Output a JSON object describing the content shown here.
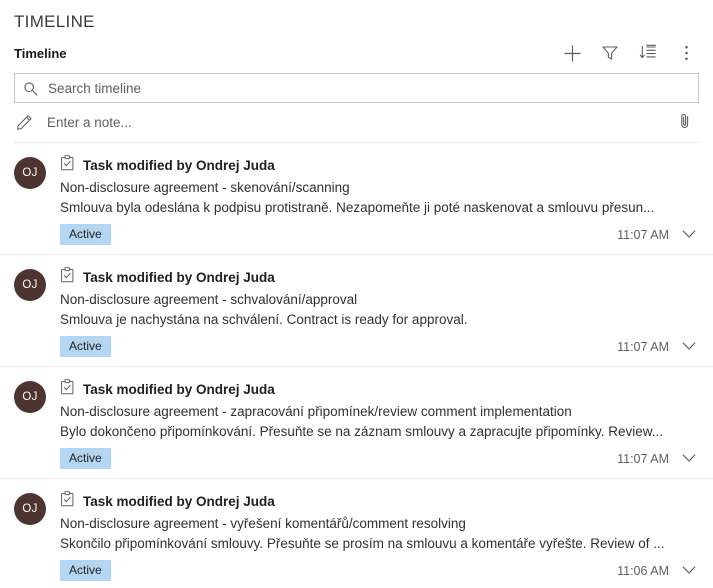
{
  "panel": {
    "title": "TIMELINE",
    "section_label": "Timeline"
  },
  "toolbar": {
    "add_label": "Add",
    "filter_label": "Filter",
    "sort_label": "Sort",
    "more_label": "More commands",
    "icons": [
      "plus-icon",
      "filter-icon",
      "sort-icon",
      "more-vertical-icon"
    ]
  },
  "search": {
    "placeholder": "Search timeline",
    "value": "",
    "icon": "search-icon"
  },
  "note": {
    "placeholder": "Enter a note...",
    "value": "",
    "icon": "pencil-icon",
    "attach_icon": "paperclip-icon",
    "attach_label": "Attach"
  },
  "colors": {
    "avatar_bg": "#4e342e",
    "badge_bg": "#b3d6f2",
    "border": "#edebe9",
    "input_border": "#c8c6c4",
    "text": "#323130"
  },
  "records": [
    {
      "avatar_initials": "OJ",
      "type_icon": "task-icon",
      "title": "Task modified by Ondrej Juda",
      "subject": "Non-disclosure agreement - skenování/scanning",
      "description": "Smlouva byla odeslána k podpisu protistraně. Nezapomeňte ji poté naskenovat a smlouvu přesun...",
      "status": "Active",
      "time": "11:07 AM",
      "expand_icon": "chevron-down-icon"
    },
    {
      "avatar_initials": "OJ",
      "type_icon": "task-icon",
      "title": "Task modified by Ondrej Juda",
      "subject": "Non-disclosure agreement - schvalování/approval",
      "description": "Smlouva je nachystána na schválení. Contract is ready for approval.",
      "status": "Active",
      "time": "11:07 AM",
      "expand_icon": "chevron-down-icon"
    },
    {
      "avatar_initials": "OJ",
      "type_icon": "task-icon",
      "title": "Task modified by Ondrej Juda",
      "subject": "Non-disclosure agreement - zapracování připomínek/review comment implementation",
      "description": "Bylo dokončeno připomínkování. Přesuňte se na záznam smlouvy a zapracujte připomínky. Review...",
      "status": "Active",
      "time": "11:07 AM",
      "expand_icon": "chevron-down-icon"
    },
    {
      "avatar_initials": "OJ",
      "type_icon": "task-icon",
      "title": "Task modified by Ondrej Juda",
      "subject": "Non-disclosure agreement - vyřešení komentářů/comment resolving",
      "description": "Skončilo připomínkování smlouvy. Přesuňte se prosím na smlouvu a komentáře vyřešte. Review of ...",
      "status": "Active",
      "time": "11:06 AM",
      "expand_icon": "chevron-down-icon"
    }
  ]
}
